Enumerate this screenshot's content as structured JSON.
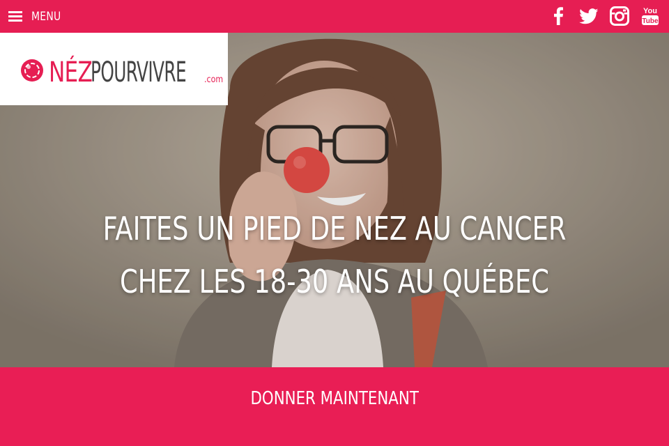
{
  "topbar": {
    "menu_label": "MENU",
    "social_icons": [
      "facebook-icon",
      "twitter-icon",
      "instagram-icon",
      "youtube-icon"
    ],
    "youtube_text": {
      "top": "You",
      "bottom": "Tube"
    }
  },
  "logo": {
    "part1": "NÉZ",
    "part2": "POURVIVRE",
    "part3": ".com"
  },
  "hero": {
    "line1": "FAITES UN PIED DE NEZ AU CANCER",
    "line2": "CHEZ LES 18-30 ANS AU QUÉBEC"
  },
  "cta": {
    "label": "DONNER MAINTENANT"
  },
  "colors": {
    "brand_pink": "#e61e53",
    "text_white": "#ffffff",
    "logo_gray": "#444444"
  }
}
